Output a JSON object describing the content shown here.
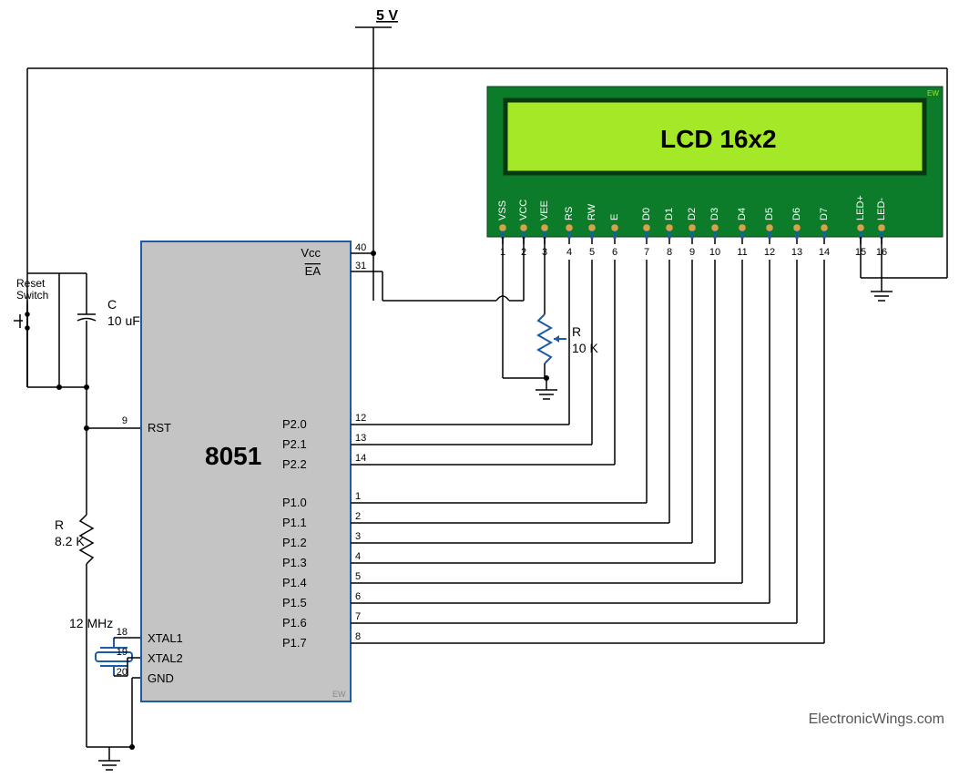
{
  "title": "5 V",
  "mcu": {
    "name": "8051",
    "pins_left": [
      {
        "num": "9",
        "label": "RST"
      },
      {
        "num": "18",
        "label": "XTAL1"
      },
      {
        "num": "19",
        "label": "XTAL2"
      },
      {
        "num": "20",
        "label": "GND"
      }
    ],
    "pins_right_top": [
      {
        "num": "40",
        "label": "Vcc"
      },
      {
        "num": "31",
        "label": "EA",
        "overline": true
      }
    ],
    "pins_right_p2": [
      {
        "num": "12",
        "label": "P2.0"
      },
      {
        "num": "13",
        "label": "P2.1"
      },
      {
        "num": "14",
        "label": "P2.2"
      }
    ],
    "pins_right_p1": [
      {
        "num": "1",
        "label": "P1.0"
      },
      {
        "num": "2",
        "label": "P1.1"
      },
      {
        "num": "3",
        "label": "P1.2"
      },
      {
        "num": "4",
        "label": "P1.3"
      },
      {
        "num": "5",
        "label": "P1.4"
      },
      {
        "num": "6",
        "label": "P1.5"
      },
      {
        "num": "7",
        "label": "P1.6"
      },
      {
        "num": "8",
        "label": "P1.7"
      }
    ]
  },
  "lcd": {
    "display_text": "LCD 16x2",
    "pins": [
      {
        "num": "1",
        "label": "VSS"
      },
      {
        "num": "2",
        "label": "VCC"
      },
      {
        "num": "3",
        "label": "VEE"
      },
      {
        "num": "4",
        "label": "RS"
      },
      {
        "num": "5",
        "label": "RW"
      },
      {
        "num": "6",
        "label": "E"
      },
      {
        "num": "7",
        "label": "D0"
      },
      {
        "num": "8",
        "label": "D1"
      },
      {
        "num": "9",
        "label": "D2"
      },
      {
        "num": "10",
        "label": "D3"
      },
      {
        "num": "11",
        "label": "D4"
      },
      {
        "num": "12",
        "label": "D5"
      },
      {
        "num": "13",
        "label": "D6"
      },
      {
        "num": "14",
        "label": "D7"
      },
      {
        "num": "15",
        "label": "LED+"
      },
      {
        "num": "16",
        "label": "LED-"
      }
    ]
  },
  "components": {
    "reset_switch": "Reset\nSwitch",
    "cap_c": "C",
    "cap_val": "10 uF",
    "res_r1": "R",
    "res_r1_val": "8.2 K",
    "res_r2": "R",
    "res_r2_val": "10 K",
    "crystal": "12 MHz"
  },
  "watermark": "ElectronicWings.com",
  "ew_small": "EW"
}
